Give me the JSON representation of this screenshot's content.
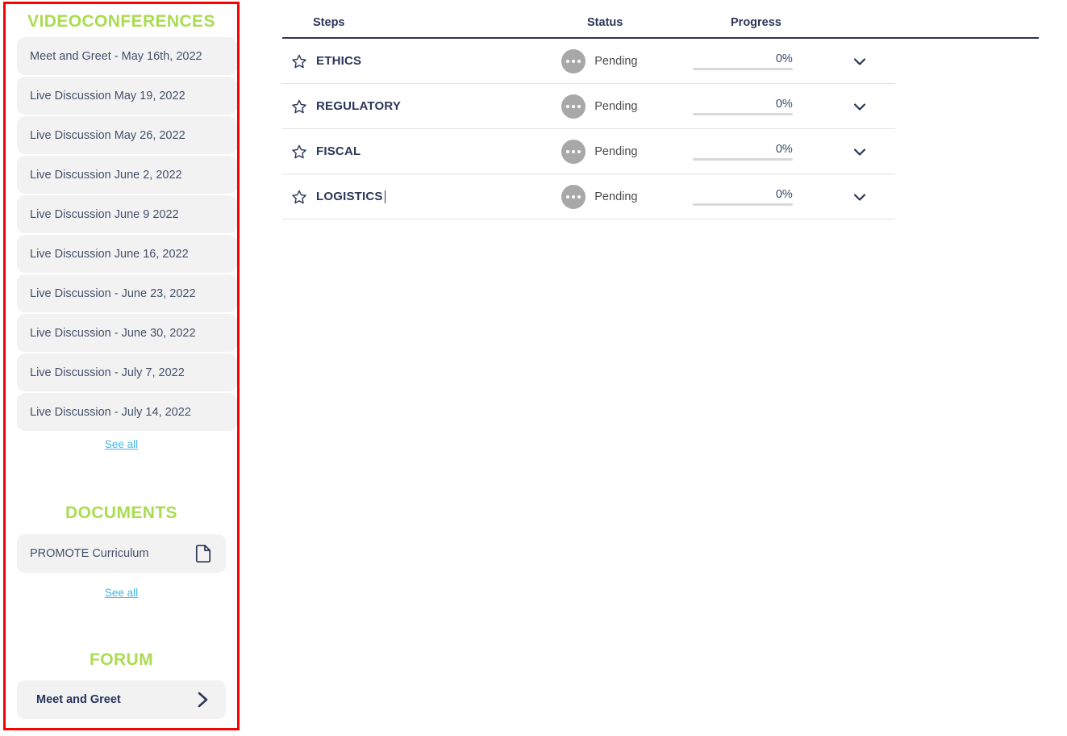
{
  "colors": {
    "accent_green": "#a9dc4f",
    "highlight_border": "#fe0000",
    "link_blue": "#43b7e8",
    "navy": "#2b3658",
    "status_gray": "#a8a8a8"
  },
  "sidebar": {
    "videoconferences": {
      "title": "VIDEOCONFERENCES",
      "items": [
        {
          "label": "Meet and Greet - May 16th, 2022"
        },
        {
          "label": "Live Discussion May 19, 2022"
        },
        {
          "label": "Live Discussion May 26, 2022"
        },
        {
          "label": "Live Discussion June 2, 2022"
        },
        {
          "label": "Live Discussion June 9 2022"
        },
        {
          "label": "Live Discussion June 16, 2022"
        },
        {
          "label": "Live Discussion - June 23, 2022"
        },
        {
          "label": "Live Discussion - June 30, 2022"
        },
        {
          "label": "Live Discussion - July 7, 2022"
        },
        {
          "label": "Live Discussion - July 14, 2022"
        }
      ],
      "see_all": "See all"
    },
    "documents": {
      "title": "DOCUMENTS",
      "items": [
        {
          "label": "PROMOTE Curriculum",
          "icon": "document-icon"
        }
      ],
      "see_all": "See all"
    },
    "forum": {
      "title": "FORUM",
      "items": [
        {
          "label": "Meet and Greet",
          "icon": "chevron-right-icon"
        }
      ]
    }
  },
  "table": {
    "columns": {
      "steps": "Steps",
      "status": "Status",
      "progress": "Progress"
    },
    "rows": [
      {
        "star": "star-icon",
        "name": "ETHICS",
        "status": "Pending",
        "status_icon": "ellipsis-circle-icon",
        "progress": "0%",
        "progress_value": 0,
        "expand": "chevron-down-icon",
        "editing": false
      },
      {
        "star": "star-icon",
        "name": "REGULATORY",
        "status": "Pending",
        "status_icon": "ellipsis-circle-icon",
        "progress": "0%",
        "progress_value": 0,
        "expand": "chevron-down-icon",
        "editing": false
      },
      {
        "star": "star-icon",
        "name": "FISCAL",
        "status": "Pending",
        "status_icon": "ellipsis-circle-icon",
        "progress": "0%",
        "progress_value": 0,
        "expand": "chevron-down-icon",
        "editing": false
      },
      {
        "star": "star-icon",
        "name": "LOGISTICS",
        "status": "Pending",
        "status_icon": "ellipsis-circle-icon",
        "progress": "0%",
        "progress_value": 0,
        "expand": "chevron-down-icon",
        "editing": true
      }
    ]
  }
}
